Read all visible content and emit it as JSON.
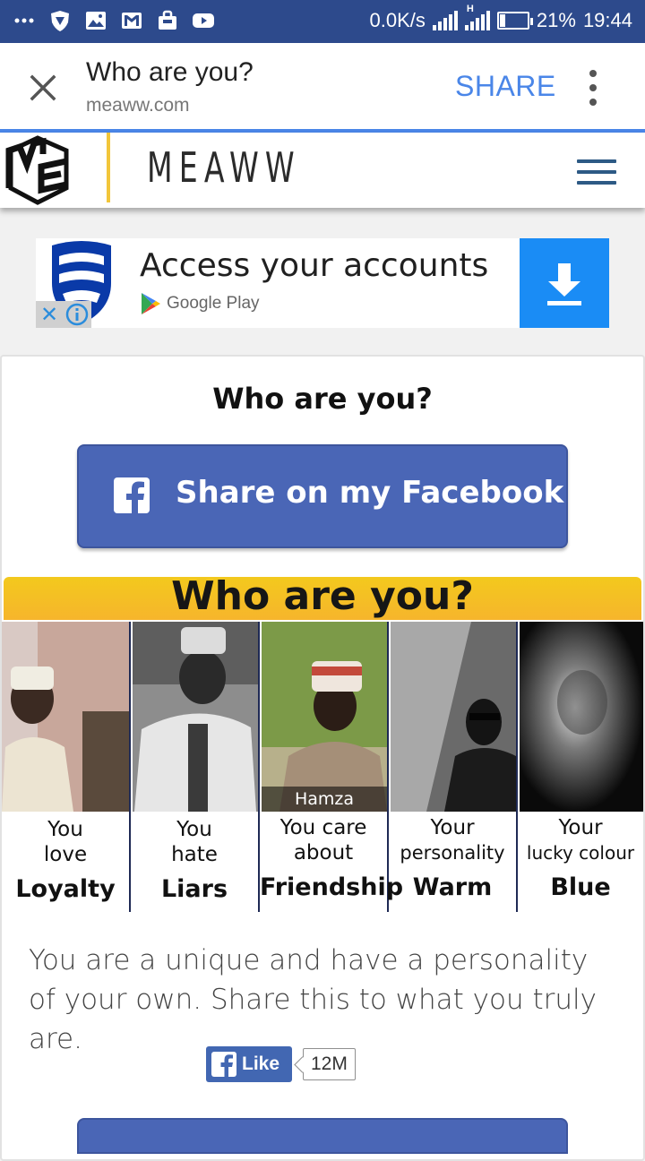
{
  "status_bar": {
    "network_speed": "0.0K/s",
    "network_type": "H",
    "battery": "21%",
    "battery_level": 0.21,
    "time": "19:44",
    "icons": [
      "more-dots-icon",
      "shield-icon",
      "image-icon",
      "gmail-icon",
      "bag-icon",
      "youtube-icon",
      "signal-icon",
      "signal-h-icon",
      "battery-icon"
    ]
  },
  "browser_toolbar": {
    "title": "Who are you?",
    "url": "meaww.com",
    "share_label": "SHARE",
    "page_load_progress": 1.0
  },
  "site_header": {
    "brand": "MEAWW",
    "logo_text": "ME",
    "accent_color": "#f2c63a"
  },
  "ad": {
    "headline": "Access your accounts",
    "store": "Google Play",
    "close_symbol": "✕",
    "download_color": "#1a8cf5"
  },
  "quiz": {
    "title": "Who are you?",
    "share_button_label": "Share on my Facebook",
    "facebook_color": "#4a66b6",
    "result_image": {
      "heading": "Who are you?",
      "name": "Hamza",
      "columns": [
        {
          "question_line1": "You",
          "question_line2": "love",
          "answer": "Loyalty"
        },
        {
          "question_line1": "You",
          "question_line2": "hate",
          "answer": "Liars"
        },
        {
          "question_line1": "You care",
          "question_line2": "about",
          "answer": "Friendship"
        },
        {
          "question_line1": "Your",
          "question_line2": "personality",
          "answer": "Warm"
        },
        {
          "question_line1": "Your",
          "question_line2": "lucky colour",
          "answer": "Blue"
        }
      ]
    },
    "description": "You are a unique and have a personality of your own. Share this to what you truly are.",
    "like": {
      "label": "Like",
      "count": "12M"
    }
  }
}
